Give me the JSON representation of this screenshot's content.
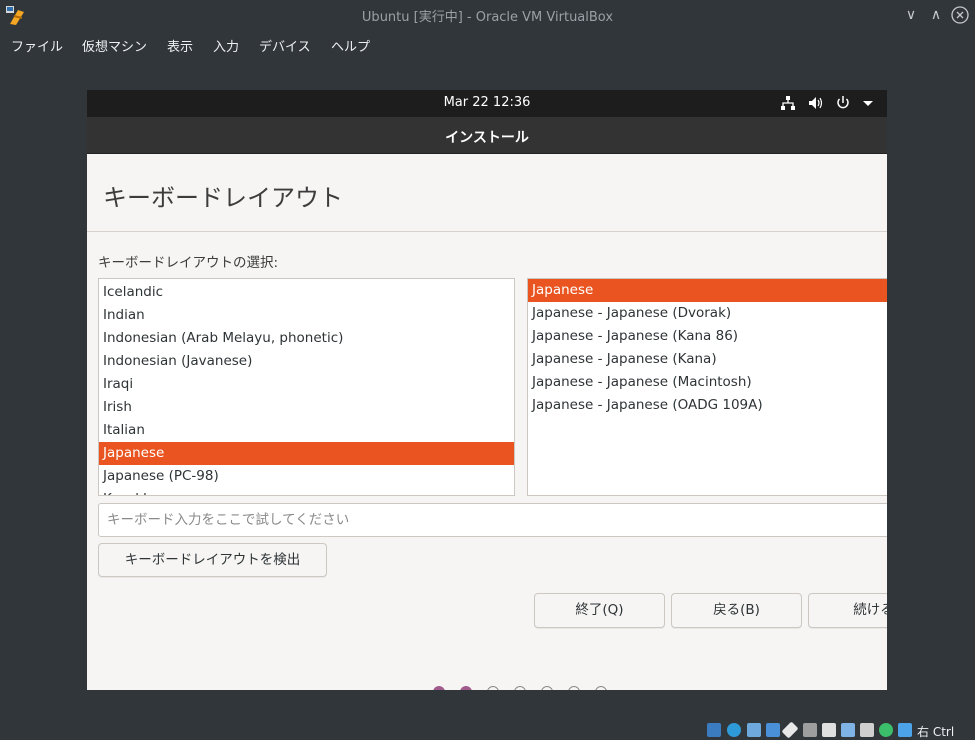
{
  "host": {
    "title": "Ubuntu [実行中] - Oracle VM VirtualBox",
    "menu": [
      "ファイル",
      "仮想マシン",
      "表示",
      "入力",
      "デバイス",
      "ヘルプ"
    ],
    "minimize_glyph": "∨",
    "maximize_glyph": "∧",
    "status_text": "右 Ctrl"
  },
  "vm": {
    "clock": "Mar 22  12:36",
    "installer_title": "インストール",
    "page_title": "キーボードレイアウト",
    "section_label": "キーボードレイアウトの選択:",
    "layouts": [
      "Icelandic",
      "Indian",
      "Indonesian (Arab Melayu, phonetic)",
      "Indonesian (Javanese)",
      "Iraqi",
      "Irish",
      "Italian",
      "Japanese",
      "Japanese (PC-98)",
      "Kazakh"
    ],
    "layouts_selected": "Japanese",
    "variants": [
      "Japanese",
      "Japanese - Japanese (Dvorak)",
      "Japanese - Japanese (Kana 86)",
      "Japanese - Japanese (Kana)",
      "Japanese - Japanese (Macintosh)",
      "Japanese - Japanese (OADG 109A)"
    ],
    "variants_selected": "Japanese",
    "test_placeholder": "キーボード入力をここで試してください",
    "detect_button": "キーボードレイアウトを検出",
    "quit_button": "終了(Q)",
    "back_button": "戻る(B)",
    "continue_button": "続ける",
    "progress": {
      "total": 7,
      "current": 2
    }
  },
  "colors": {
    "accent": "#e95420",
    "progress_dot": "#a05a8c"
  }
}
